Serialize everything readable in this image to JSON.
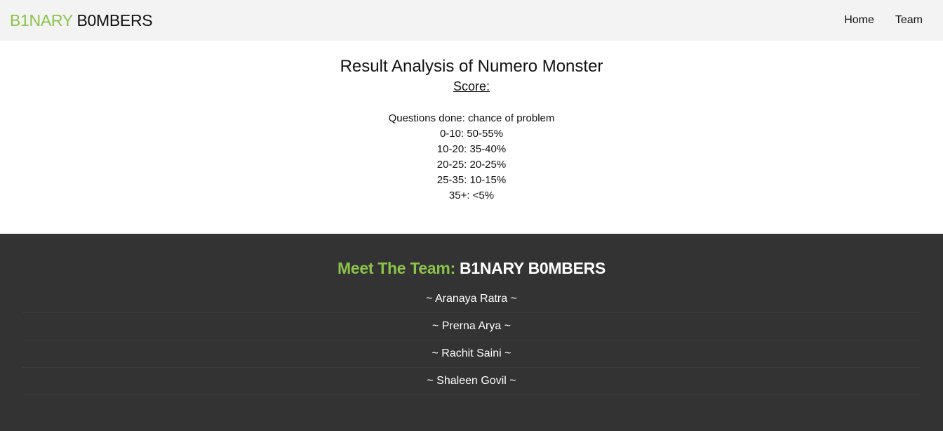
{
  "navbar": {
    "brand_part1": "B1NARY",
    "brand_part2": " B0MBERS",
    "links": [
      {
        "label": "Home"
      },
      {
        "label": "Team"
      }
    ]
  },
  "main": {
    "title": "Result Analysis of Numero Monster",
    "score_label": "Score:",
    "analysis_lines": [
      "Questions done: chance of problem",
      "0-10: 50-55%",
      "10-20: 35-40%",
      "20-25: 20-25%",
      "25-35: 10-15%",
      "35+: <5%"
    ]
  },
  "footer": {
    "heading_part1": "Meet The Team:",
    "heading_part2": " B1NARY B0MBERS",
    "members": [
      "~ Aranaya Ratra ~",
      "~ Prerna Arya ~",
      "~ Rachit Saini ~",
      "~ Shaleen Govil ~"
    ]
  },
  "colors": {
    "accent_green": "#8bc34a",
    "navbar_bg": "#f3f3f3",
    "footer_bg": "#333333"
  }
}
